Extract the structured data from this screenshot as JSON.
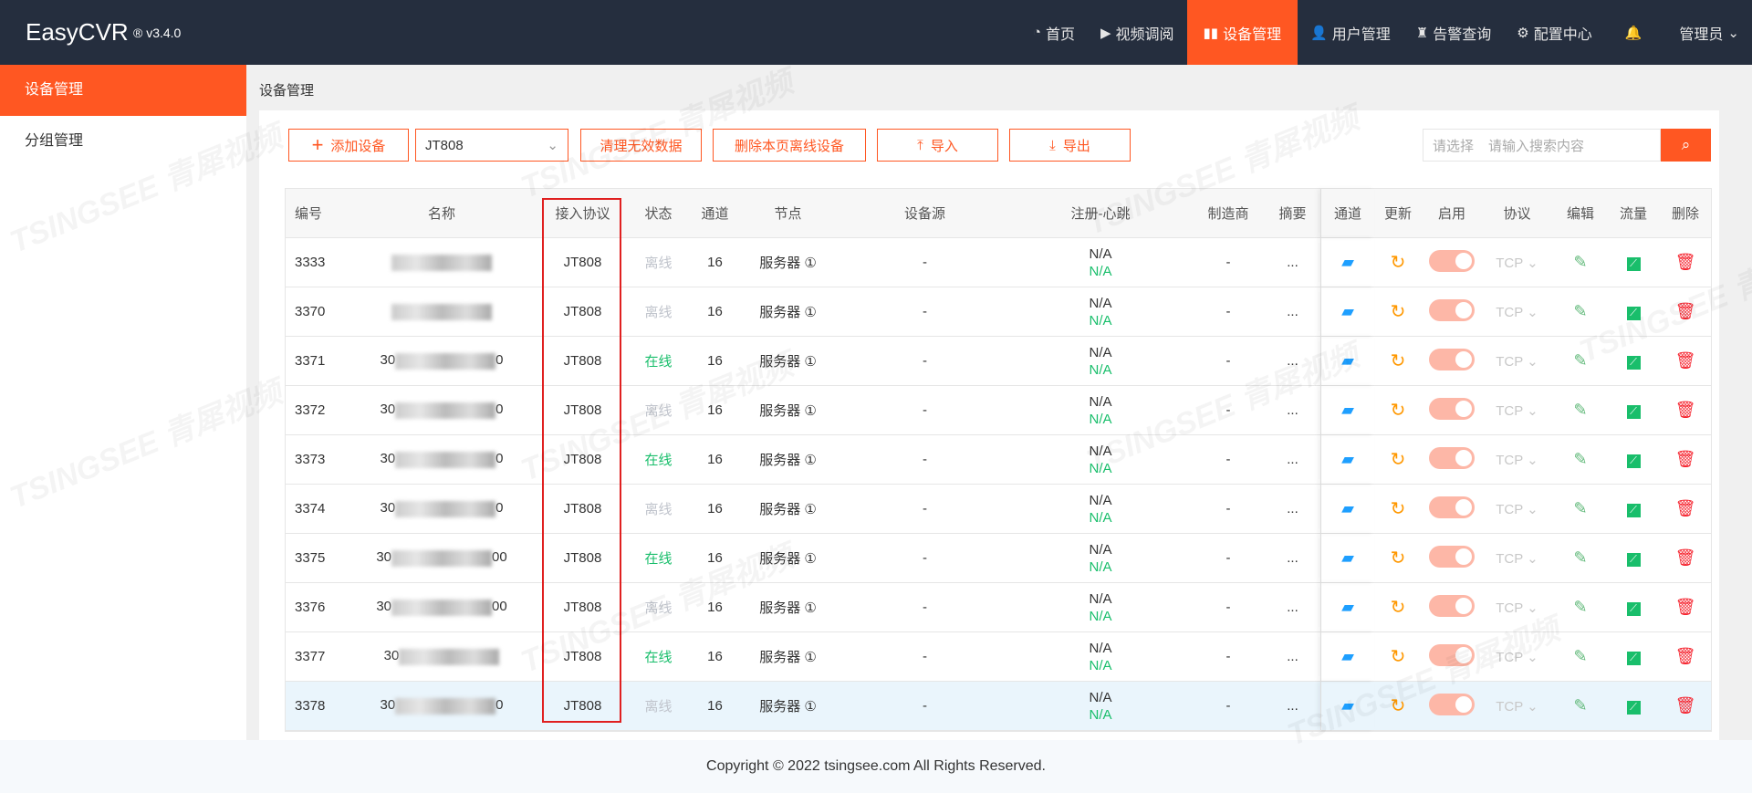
{
  "header": {
    "logo": "EasyCVR",
    "version": "® v3.4.0",
    "nav": [
      {
        "icon": "dashboard-icon",
        "glyph": "◔",
        "label": "首页"
      },
      {
        "icon": "play-icon",
        "glyph": "▶",
        "label": "视频调阅"
      },
      {
        "icon": "device-icon",
        "glyph": "▮▮",
        "label": "设备管理",
        "active": true
      },
      {
        "icon": "user-icon",
        "glyph": "👤",
        "label": "用户管理"
      },
      {
        "icon": "alarm-icon",
        "glyph": "♜",
        "label": "告警查询"
      },
      {
        "icon": "gear-icon",
        "glyph": "⚙",
        "label": "配置中心"
      },
      {
        "icon": "bell-icon",
        "glyph": "🔔",
        "label": ""
      },
      {
        "icon": "chevron-down-icon",
        "glyph": "⌄",
        "label": "管理员"
      }
    ]
  },
  "sidebar": {
    "items": [
      {
        "label": "设备管理",
        "active": true
      },
      {
        "label": "分组管理"
      }
    ]
  },
  "breadcrumb": "设备管理",
  "toolbar": {
    "add": "添加设备",
    "protocol_select": "JT808",
    "clean": "清理无效数据",
    "delete_offline": "删除本页离线设备",
    "import": "导入",
    "export": "导出",
    "search_select_placeholder": "请选择",
    "search_placeholder": "请输入搜索内容"
  },
  "table": {
    "headers": [
      "编号",
      "名称",
      "接入协议",
      "状态",
      "通道",
      "节点",
      "设备源",
      "注册-心跳",
      "制造商",
      "摘要",
      "通道",
      "更新",
      "启用",
      "协议",
      "编辑",
      "流量",
      "删除"
    ],
    "rows": [
      {
        "id": "3333",
        "name_pre": "",
        "name_suf": "",
        "protocol": "JT808",
        "status": "离线",
        "channels": "16",
        "node": "服务器 ①",
        "source": "-",
        "reg": "N/A",
        "hb": "N/A",
        "maker": "-",
        "summary": "...",
        "proto": "TCP"
      },
      {
        "id": "3370",
        "name_pre": "",
        "name_suf": "",
        "protocol": "JT808",
        "status": "离线",
        "channels": "16",
        "node": "服务器 ①",
        "source": "-",
        "reg": "N/A",
        "hb": "N/A",
        "maker": "-",
        "summary": "...",
        "proto": "TCP"
      },
      {
        "id": "3371",
        "name_pre": "30",
        "name_suf": "0",
        "protocol": "JT808",
        "status": "在线",
        "channels": "16",
        "node": "服务器 ①",
        "source": "-",
        "reg": "N/A",
        "hb": "N/A",
        "maker": "-",
        "summary": "...",
        "proto": "TCP"
      },
      {
        "id": "3372",
        "name_pre": "30",
        "name_suf": "0",
        "protocol": "JT808",
        "status": "离线",
        "channels": "16",
        "node": "服务器 ①",
        "source": "-",
        "reg": "N/A",
        "hb": "N/A",
        "maker": "-",
        "summary": "...",
        "proto": "TCP"
      },
      {
        "id": "3373",
        "name_pre": "30",
        "name_suf": "0",
        "protocol": "JT808",
        "status": "在线",
        "channels": "16",
        "node": "服务器 ①",
        "source": "-",
        "reg": "N/A",
        "hb": "N/A",
        "maker": "-",
        "summary": "...",
        "proto": "TCP"
      },
      {
        "id": "3374",
        "name_pre": "30",
        "name_suf": "0",
        "protocol": "JT808",
        "status": "离线",
        "channels": "16",
        "node": "服务器 ①",
        "source": "-",
        "reg": "N/A",
        "hb": "N/A",
        "maker": "-",
        "summary": "...",
        "proto": "TCP"
      },
      {
        "id": "3375",
        "name_pre": "30",
        "name_suf": "00",
        "protocol": "JT808",
        "status": "在线",
        "channels": "16",
        "node": "服务器 ①",
        "source": "-",
        "reg": "N/A",
        "hb": "N/A",
        "maker": "-",
        "summary": "...",
        "proto": "TCP"
      },
      {
        "id": "3376",
        "name_pre": "30",
        "name_suf": "00",
        "protocol": "JT808",
        "status": "离线",
        "channels": "16",
        "node": "服务器 ①",
        "source": "-",
        "reg": "N/A",
        "hb": "N/A",
        "maker": "-",
        "summary": "...",
        "proto": "TCP"
      },
      {
        "id": "3377",
        "name_pre": "30",
        "name_suf": "",
        "protocol": "JT808",
        "status": "在线",
        "channels": "16",
        "node": "服务器 ①",
        "source": "-",
        "reg": "N/A",
        "hb": "N/A",
        "maker": "-",
        "summary": "...",
        "proto": "TCP"
      },
      {
        "id": "3378",
        "name_pre": "30",
        "name_suf": "0",
        "protocol": "JT808",
        "status": "离线",
        "channels": "16",
        "node": "服务器 ①",
        "source": "-",
        "reg": "N/A",
        "hb": "N/A",
        "maker": "-",
        "summary": "...",
        "proto": "TCP"
      }
    ]
  },
  "footer": "Copyright © 2022 tsingsee.com All Rights Reserved.",
  "watermark": "TSINGSEE 青犀视频",
  "colors": {
    "accent": "#ff5722",
    "online": "#19be6b",
    "offline": "#c0c4cc",
    "header_bg": "#252e3e"
  }
}
